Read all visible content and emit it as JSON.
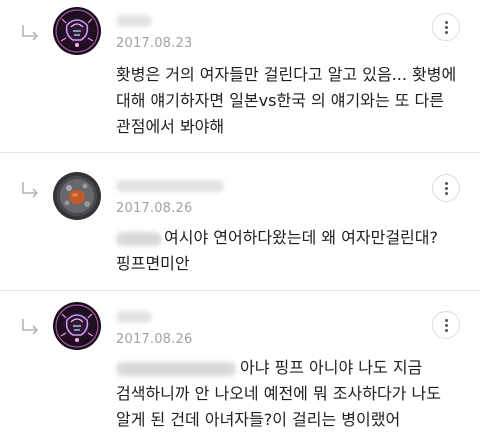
{
  "comments": [
    {
      "date": "2017.08.23",
      "text": "홧병은 거의 여자들만 걸린다고 알고 있음... 홧병에 대해 얘기하자면 일본vs한국 의 얘기와는 또 다른 관점에서 봐야해"
    },
    {
      "date": "2017.08.26",
      "text": "여시야 연어하다왔는데 왜 여자만걸린대? 핑프면미안"
    },
    {
      "date": "2017.08.26",
      "text": "아냐 핑프 아니야 나도 지금 검색하니까 안 나오네 예전에 뭐 조사하다가 나도 알게 된 건데 아녀자들?이 걸리는 병이랬어"
    }
  ]
}
